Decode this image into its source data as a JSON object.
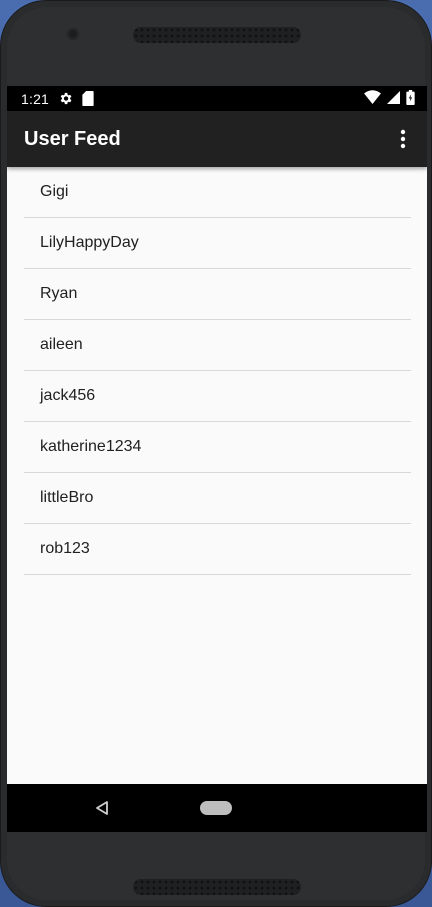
{
  "statusbar": {
    "time": "1:21",
    "icons_left": [
      "gear-icon",
      "sd-card-icon"
    ],
    "icons_right": [
      "wifi-icon",
      "signal-icon",
      "battery-icon"
    ]
  },
  "appbar": {
    "title": "User Feed",
    "menu_icon": "more-vert-icon"
  },
  "user_list": [
    {
      "name": "Gigi"
    },
    {
      "name": "LilyHappyDay"
    },
    {
      "name": "Ryan"
    },
    {
      "name": "aileen"
    },
    {
      "name": "jack456"
    },
    {
      "name": "katherine1234"
    },
    {
      "name": "littleBro"
    },
    {
      "name": "rob123"
    }
  ],
  "navbar": {
    "back_icon": "back-triangle-icon",
    "home_icon": "home-pill-icon"
  },
  "colors": {
    "appbar_bg": "#212121",
    "screen_bg": "#fafafa",
    "divider": "#d8d8d8",
    "text_primary": "#212121"
  }
}
